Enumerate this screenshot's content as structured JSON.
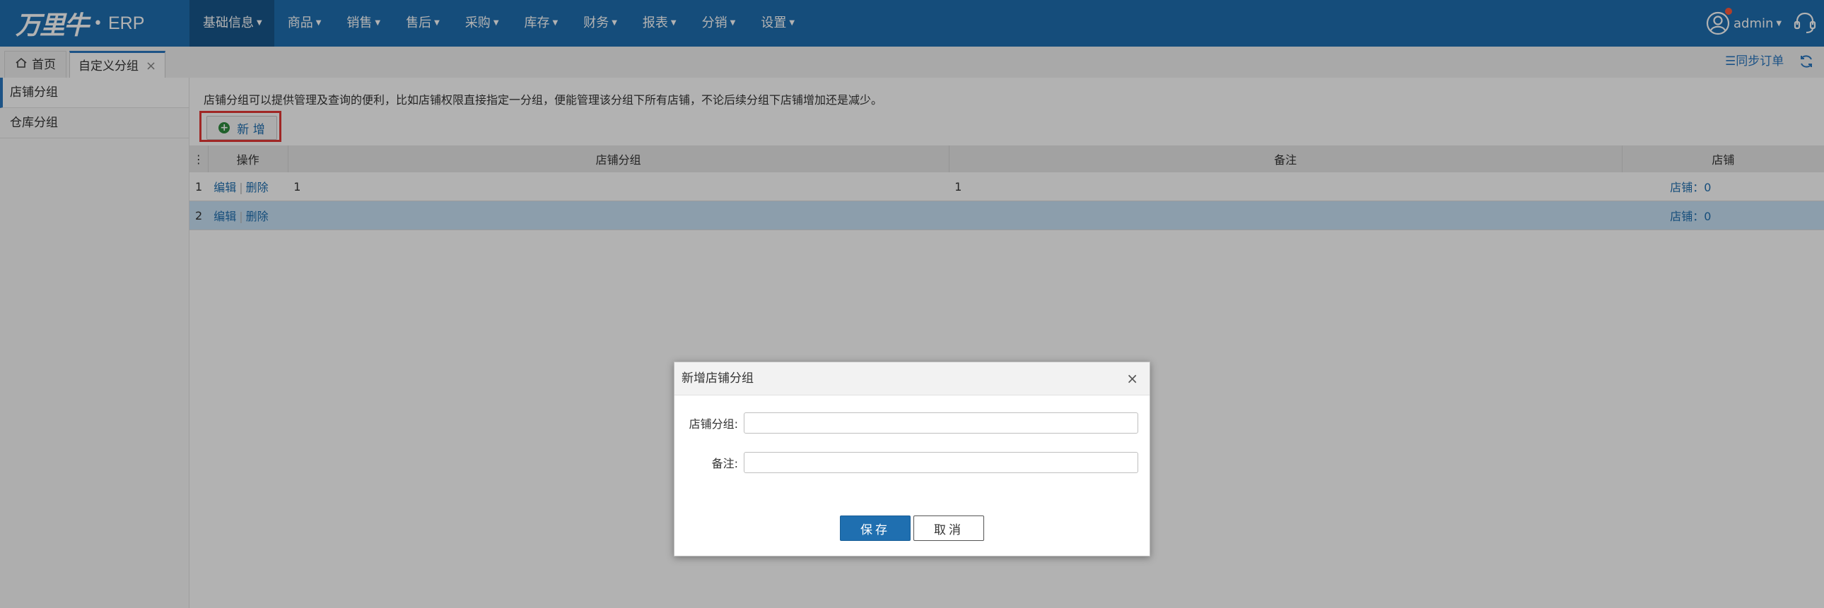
{
  "app": {
    "logo_text": "万里牛",
    "logo_dot": "•",
    "product": "ERP"
  },
  "nav": {
    "items": [
      {
        "label": "基础信息"
      },
      {
        "label": "商品"
      },
      {
        "label": "销售"
      },
      {
        "label": "售后"
      },
      {
        "label": "采购"
      },
      {
        "label": "库存"
      },
      {
        "label": "财务"
      },
      {
        "label": "报表"
      },
      {
        "label": "分销"
      },
      {
        "label": "设置"
      }
    ],
    "active_index": 0
  },
  "user": {
    "name": "admin"
  },
  "tabs": {
    "home": "首页",
    "active": "自定义分组",
    "close_glyph": "×"
  },
  "toolbar_right": {
    "sync_orders": "☰同步订单"
  },
  "sidebar": {
    "items": [
      {
        "label": "店铺分组"
      },
      {
        "label": "仓库分组"
      }
    ]
  },
  "main": {
    "hint": "店铺分组可以提供管理及查询的便利，比如店铺权限直接指定一分组，便能管理该分组下所有店铺，不论后续分组下店铺增加还是减少。",
    "add_button": "新 增",
    "columns": {
      "menu": "⋮",
      "op": "操作",
      "group": "店铺分组",
      "remark": "备注",
      "shop": "店铺"
    },
    "rows": [
      {
        "index": "1",
        "edit": "编辑",
        "sep": "|",
        "delete": "删除",
        "group": "1",
        "remark": "1",
        "shop": "店铺：0"
      },
      {
        "index": "2",
        "edit": "编辑",
        "sep": "|",
        "delete": "删除",
        "group": "",
        "remark": "",
        "shop": "店铺：0"
      }
    ]
  },
  "modal": {
    "title": "新增店铺分组",
    "close": "×",
    "fields": [
      {
        "label": "店铺分组:",
        "value": ""
      },
      {
        "label": "备注:",
        "value": ""
      }
    ],
    "save": "保存",
    "cancel": "取消"
  },
  "colors": {
    "header": "#1f6fb0",
    "active_nav": "#18578c",
    "selected_row": "#c9e3f7",
    "highlight": "#e53935"
  }
}
